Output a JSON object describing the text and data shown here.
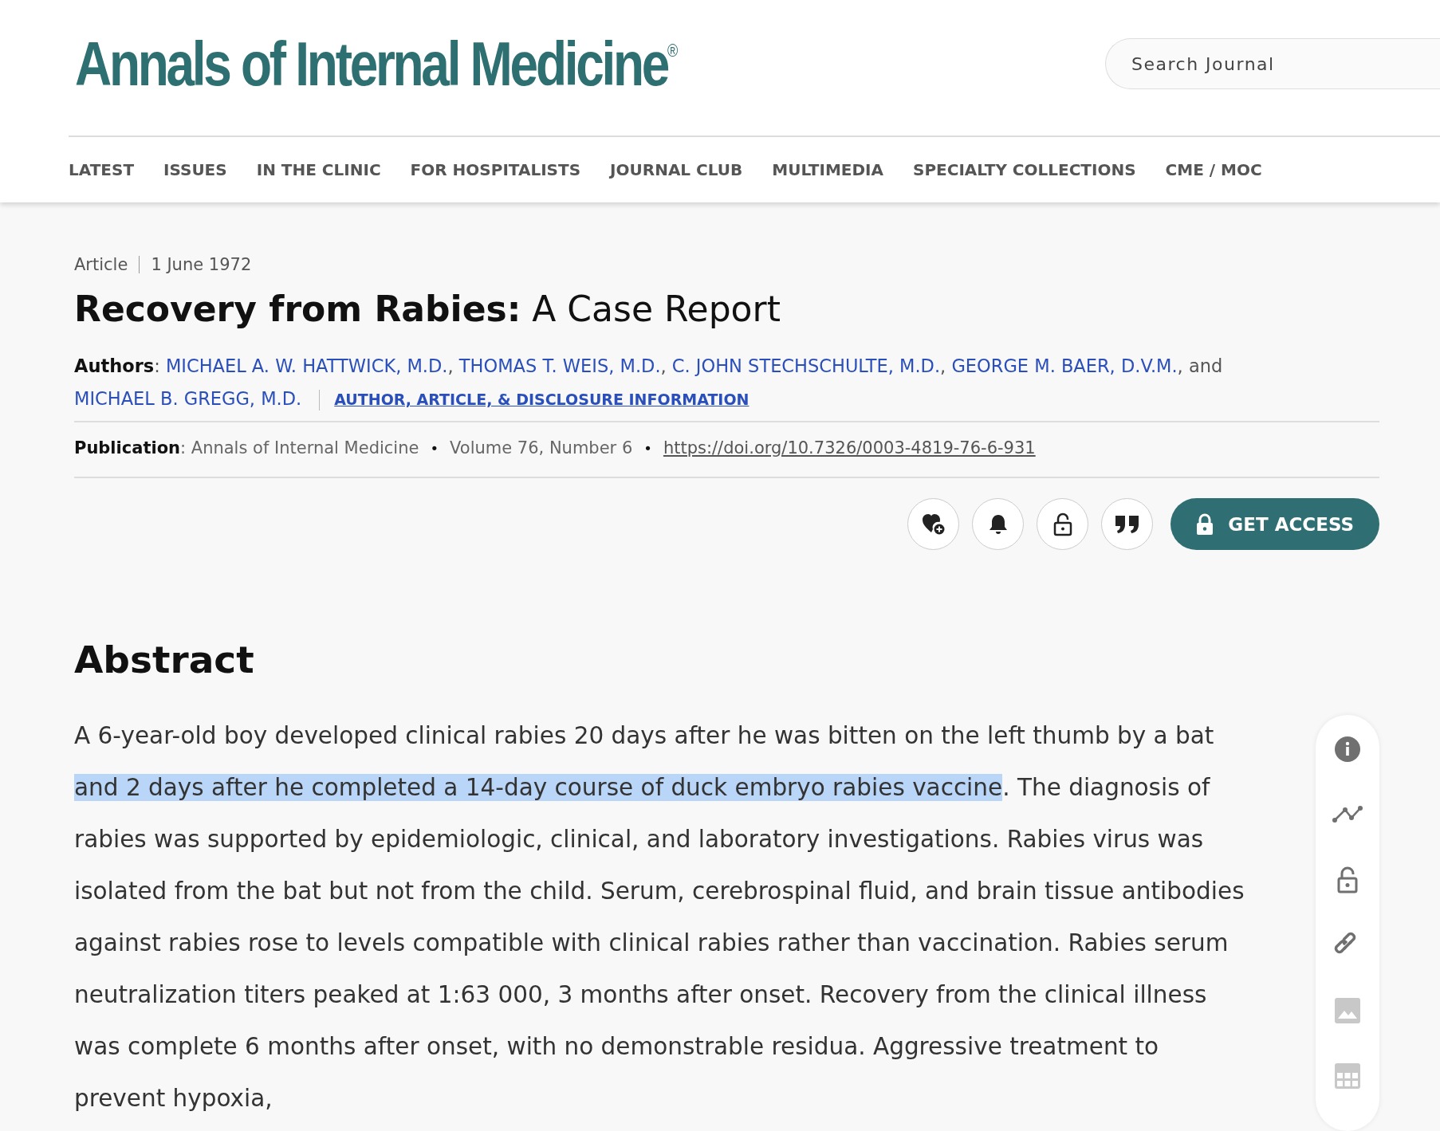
{
  "header": {
    "logo": "Annals of Internal Medicine",
    "logo_mark": "®",
    "search": {
      "placeholder": "Search Journal"
    }
  },
  "nav": [
    "LATEST",
    "ISSUES",
    "IN THE CLINIC",
    "FOR HOSPITALISTS",
    "JOURNAL CLUB",
    "MULTIMEDIA",
    "SPECIALTY COLLECTIONS",
    "CME / MOC"
  ],
  "article": {
    "type": "Article",
    "date": "1 June 1972",
    "title": "Recovery from Rabies:",
    "subtitle": "A Case Report",
    "authors_line": [
      {
        "kind": "label",
        "text": "Authors"
      },
      {
        "kind": "text",
        "text": ": "
      },
      {
        "kind": "link",
        "text": "MICHAEL A. W. HATTWICK, M.D."
      },
      {
        "kind": "text",
        "text": ", "
      },
      {
        "kind": "link",
        "text": "THOMAS T. WEIS, M.D."
      },
      {
        "kind": "text",
        "text": ", "
      },
      {
        "kind": "link",
        "text": "C. JOHN STECHSCHULTE, M.D."
      },
      {
        "kind": "text",
        "text": ", "
      },
      {
        "kind": "link",
        "text": "GEORGE M. BAER, D.V.M."
      },
      {
        "kind": "text",
        "text": ", and "
      },
      {
        "kind": "link",
        "text": "MICHAEL B. GREGG, M.D."
      }
    ],
    "info_link": "AUTHOR, ARTICLE, & DISCLOSURE INFORMATION",
    "publication_line": [
      {
        "kind": "label",
        "text": "Publication"
      },
      {
        "kind": "text",
        "text": ": Annals of Internal Medicine"
      },
      {
        "kind": "bullet",
        "text": "•"
      },
      {
        "kind": "text",
        "text": "Volume 76, Number 6"
      },
      {
        "kind": "bullet",
        "text": "•"
      },
      {
        "kind": "url",
        "text": "https://doi.org/10.7326/0003-4819-76-6-931"
      }
    ]
  },
  "actions": [
    {
      "kind": "favorite"
    },
    {
      "kind": "alert"
    },
    {
      "kind": "access"
    },
    {
      "kind": "cite"
    }
  ],
  "get_access": "GET ACCESS",
  "abstract": {
    "heading": "Abstract",
    "text_before": "A 6-year-old boy developed clinical rabies 20 days after he was bitten on the left thumb by a bat ",
    "text_selected": "and 2 days after he completed a 14-day course of duck embryo rabies vaccine",
    "text_after": ". The diagnosis of rabies was supported by epidemiologic, clinical, and laboratory investigations. Rabies virus was isolated from the bat but not from the child. Serum, cerebrospinal fluid, and brain tissue antibodies against rabies rose to levels compatible with clinical rabies rather than vaccination. Rabies serum neutralization titers peaked at 1:63 000, 3 months after onset. Recovery from the clinical illness was complete 6 months after onset, with no demonstrable residua. Aggressive treatment to prevent hypoxia,"
  },
  "side_toolbar": [
    {
      "kind": "info",
      "disabled": false
    },
    {
      "kind": "metrics",
      "disabled": false
    },
    {
      "kind": "access",
      "disabled": false
    },
    {
      "kind": "link",
      "disabled": false
    },
    {
      "kind": "figures",
      "disabled": true
    },
    {
      "kind": "tables",
      "disabled": true
    }
  ]
}
